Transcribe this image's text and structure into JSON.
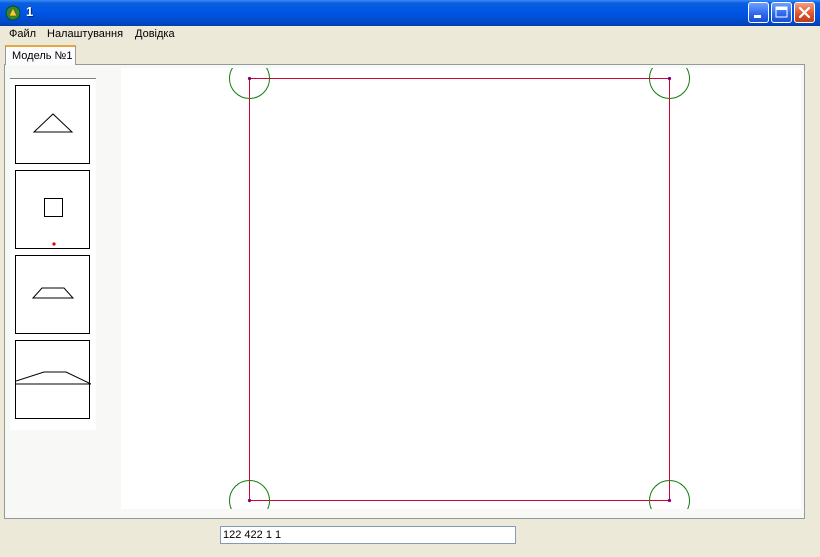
{
  "window": {
    "title": "1",
    "buttons": [
      "minimize-icon",
      "maximize-icon",
      "close-icon"
    ],
    "title_bar_color": "#0055e5"
  },
  "menu": {
    "items": [
      {
        "label": "Файл"
      },
      {
        "label": "Налаштування"
      },
      {
        "label": "Довідка"
      }
    ]
  },
  "tabs": [
    {
      "label": "Модель №1",
      "active": true
    }
  ],
  "toolbox": {
    "tools": [
      {
        "icon": "triangle-shape-icon"
      },
      {
        "icon": "square-shape-icon"
      },
      {
        "icon": "trapezoid-shape-icon"
      },
      {
        "icon": "profile-shape-icon"
      }
    ]
  },
  "canvas": {
    "shape": "rectangle",
    "corner_markers": 4,
    "colors": {
      "outline": "#d40030",
      "corner_circles": "#107c10",
      "corner_points": "#800080"
    }
  },
  "status": {
    "value": "122 422 1 1"
  }
}
